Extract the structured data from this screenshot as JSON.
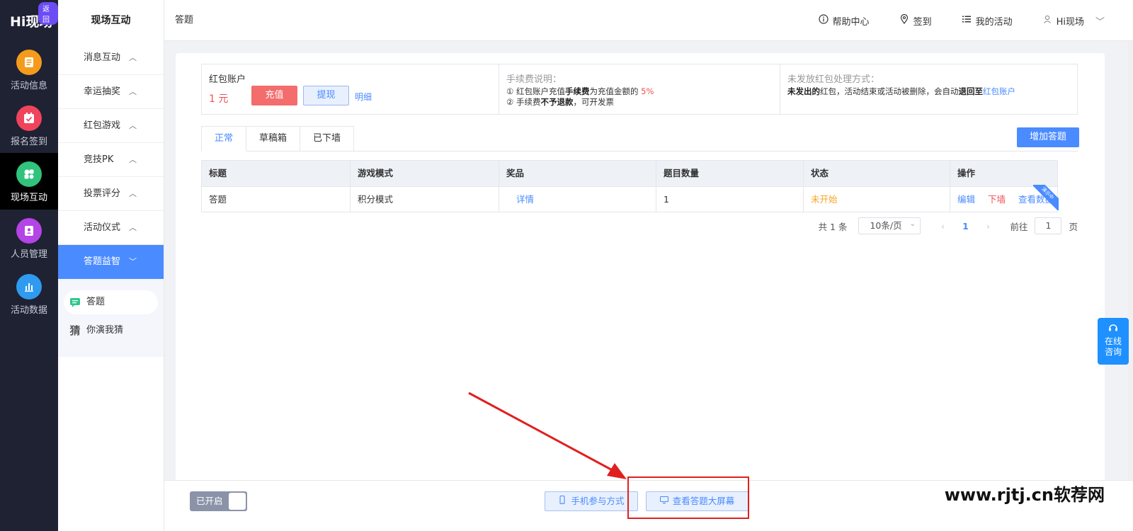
{
  "rail": {
    "logo": "Hi现场",
    "back_badge": "返回",
    "items": [
      {
        "label": "活动信息",
        "icon": "document-icon",
        "color": "#f59b1c"
      },
      {
        "label": "报名签到",
        "icon": "calendar-check-icon",
        "color": "#f0445c"
      },
      {
        "label": "现场互动",
        "icon": "interact-icon",
        "color": "#31c27c"
      },
      {
        "label": "人员管理",
        "icon": "person-card-icon",
        "color": "#b444e6"
      },
      {
        "label": "活动数据",
        "icon": "bar-chart-icon",
        "color": "#2f9bf0"
      }
    ]
  },
  "sidebar": {
    "title": "现场互动",
    "items": [
      {
        "label": "消息互动"
      },
      {
        "label": "幸运抽奖"
      },
      {
        "label": "红包游戏"
      },
      {
        "label": "竞技PK"
      },
      {
        "label": "投票评分"
      },
      {
        "label": "活动仪式"
      },
      {
        "label": "答题益智"
      }
    ],
    "sub_items": [
      {
        "label": "答题",
        "icon": "chat-bubble-icon"
      },
      {
        "label": "你演我猜",
        "icon": "guess-char-icon"
      }
    ]
  },
  "header": {
    "breadcrumb": "答题",
    "help": "帮助中心",
    "checkin": "签到",
    "my_activity": "我的活动",
    "user": "Hi现场"
  },
  "account": {
    "label": "红包账户",
    "amount": "1 元",
    "recharge": "充值",
    "withdraw": "提现",
    "detail": "明细"
  },
  "fee": {
    "title": "手续费说明：",
    "line1_a": "① 红包账户充值",
    "line1_b": "手续费",
    "line1_c": "为充值金额的 ",
    "line1_rate": "5%",
    "line2_a": "② 手续费",
    "line2_b": "不予退款",
    "line2_c": "，可开发票"
  },
  "unsent": {
    "title": "未发放红包处理方式：",
    "a": "未发出的",
    "b": "红包，活动结束或活动被删除，会自动",
    "c": "退回至",
    "d": "红包账户"
  },
  "tabs": [
    "正常",
    "草稿箱",
    "已下墙"
  ],
  "add_button": "增加答题",
  "table": {
    "headers": [
      "标题",
      "游戏模式",
      "奖品",
      "题目数量",
      "状态",
      "操作"
    ],
    "rows": [
      {
        "title": "答题",
        "mode": "积分模式",
        "prize": "详情",
        "count": "1",
        "status": "未开始",
        "ops": [
          "编辑",
          "下墙",
          "查看数据"
        ]
      }
    ],
    "ribbon": "演示中"
  },
  "pagination": {
    "total": "共 1 条",
    "page_size": "10条/页",
    "current": "1",
    "goto_label": "前往",
    "goto_value": "1",
    "page_unit": "页"
  },
  "consult": {
    "line1": "在线",
    "line2": "咨询"
  },
  "bottom": {
    "toggle": "已开启",
    "mobile_button": "手机参与方式",
    "screen_button": "查看答题大屏幕"
  },
  "watermark": "www.rjtj.cn软荐网",
  "colors": {
    "accent": "#4a8bff",
    "danger": "#f05050",
    "warning": "#f5a623",
    "rail_bg": "#1f2233"
  }
}
